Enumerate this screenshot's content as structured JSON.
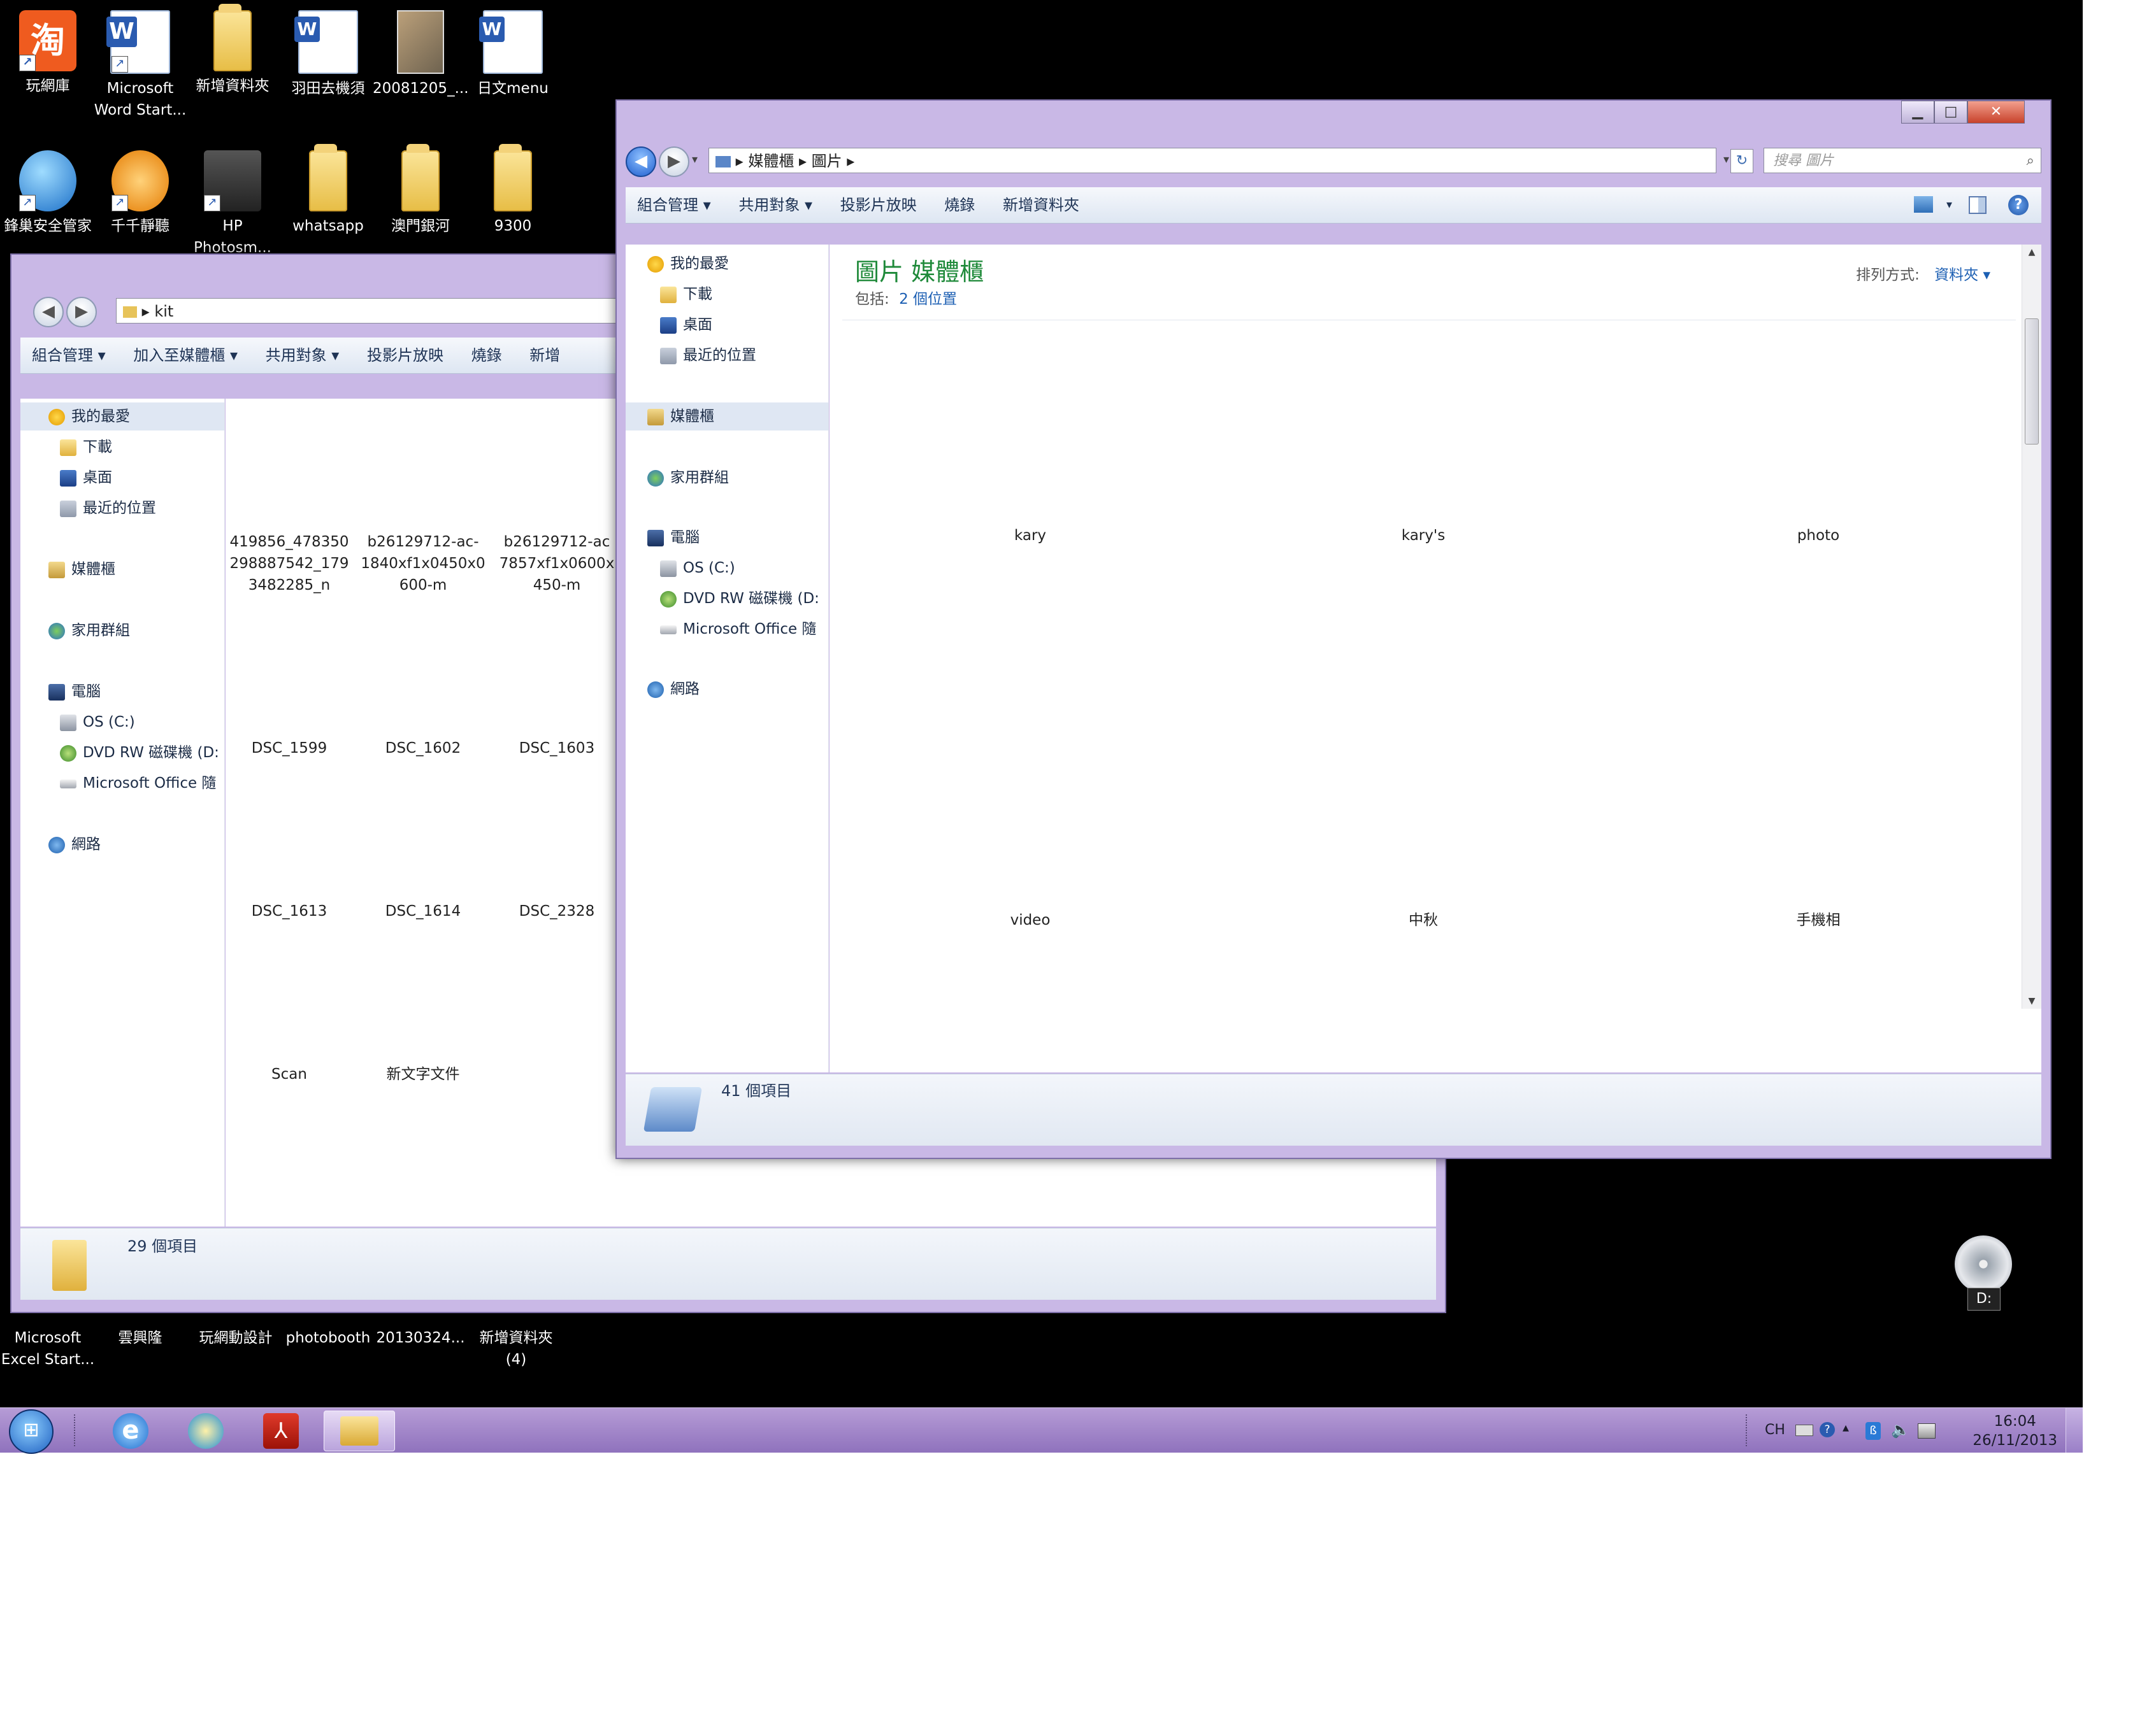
{
  "desktop_icons": {
    "row1": [
      {
        "label": "玩網庫",
        "icon": "taobao-icon"
      },
      {
        "label": "Microsoft Word Start...",
        "icon": "word-icon"
      },
      {
        "label": "新增資料夾",
        "icon": "folder-icon"
      },
      {
        "label": "羽田去機須",
        "icon": "word-doc-icon"
      },
      {
        "label": "20081205_...",
        "icon": "photo-icon"
      },
      {
        "label": "日文menu",
        "icon": "word-doc-icon"
      }
    ],
    "row2": [
      {
        "label": "鋒巢安全管家",
        "icon": "globe-icon"
      },
      {
        "label": "千千靜聽",
        "icon": "music-icon"
      },
      {
        "label": "HP Photosm...",
        "icon": "printer-icon"
      },
      {
        "label": "whatsapp",
        "icon": "folder-icon"
      },
      {
        "label": "澳門銀河",
        "icon": "folder-icon"
      },
      {
        "label": "9300",
        "icon": "folder-icon"
      }
    ],
    "bottom": [
      {
        "label": "Microsoft Excel Start...",
        "icon": "excel-icon"
      },
      {
        "label": "雲興隆",
        "icon": "folder-icon"
      },
      {
        "label": "玩網動設計",
        "icon": "globe-icon"
      },
      {
        "label": "photobooth",
        "icon": "photo-icon"
      },
      {
        "label": "20130324...",
        "icon": "photo-icon"
      },
      {
        "label": "新增資料夾 (4)",
        "icon": "folder-icon"
      }
    ]
  },
  "back_window": {
    "address": "kit",
    "toolbar": [
      "組合管理 ▾",
      "加入至媒體櫃 ▾",
      "共用對象 ▾",
      "投影片放映",
      "燒錄",
      "新增"
    ],
    "nav": {
      "favorites": "我的最愛",
      "downloads": "下載",
      "desktop": "桌面",
      "recent": "最近的位置",
      "libraries": "媒體櫃",
      "homegroup": "家用群組",
      "computer": "電腦",
      "os": "OS (C:)",
      "dvd": "DVD RW 磁碟機 (D:",
      "office": "Microsoft Office 隨",
      "network": "網路"
    },
    "files": [
      "419856_478350 298887542_179 3482285_n",
      "b26129712-ac- 1840xf1x0450x0 600-m",
      "b26129712-ac 7857xf1x0600x 450-m",
      "DSC_1599",
      "DSC_1602",
      "DSC_1603",
      "DSC_1613",
      "DSC_1614",
      "DSC_2328",
      "Scan",
      "新文字文件"
    ],
    "status": "29 個項目"
  },
  "front_window": {
    "breadcrumb": [
      "媒體櫃",
      "圖片"
    ],
    "search_placeholder": "搜尋 圖片",
    "toolbar": [
      "組合管理 ▾",
      "共用對象 ▾",
      "投影片放映",
      "燒錄",
      "新增資料夾"
    ],
    "nav": {
      "favorites": "我的最愛",
      "downloads": "下載",
      "desktop": "桌面",
      "recent": "最近的位置",
      "libraries": "媒體櫃",
      "homegroup": "家用群組",
      "computer": "電腦",
      "os": "OS (C:)",
      "dvd": "DVD RW 磁碟機 (D:",
      "office": "Microsoft Office 隨",
      "network": "網路"
    },
    "library_title": "圖片 媒體櫃",
    "library_includes_label": "包括:",
    "library_includes_value": "2 個位置",
    "arrange_label": "排列方式:",
    "arrange_value": "資料夾 ▾",
    "folders": [
      "kary",
      "kary's",
      "photo",
      "video",
      "中秋",
      "手機相"
    ],
    "status": "41 個項目"
  },
  "taskbar": {
    "tray_lang": "CH",
    "time": "16:04",
    "date": "26/11/2013",
    "dvd_label": "D:"
  },
  "colors": {
    "accent_green": "#1f8a3a",
    "link_blue": "#1c5fb3",
    "window_frame": "#c9b8e6",
    "taskbar": "#a386cc"
  }
}
